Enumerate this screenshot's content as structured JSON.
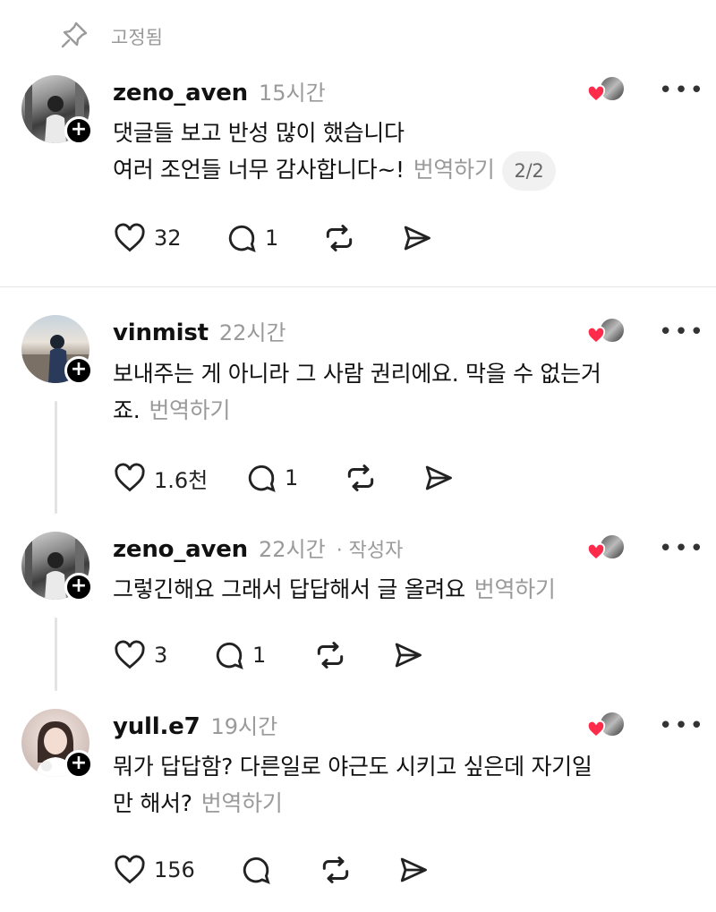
{
  "pinned": {
    "label": "고정됨"
  },
  "posts": [
    {
      "username": "zeno_aven",
      "time": "15시간",
      "lines": [
        "댓글들 보고 반성 많이 했습니다",
        "여러 조언들 너무 감사합니다~!"
      ],
      "translate": "번역하기",
      "pager": "2/2",
      "likes": "32",
      "replies": "1"
    },
    {
      "username": "vinmist",
      "time": "22시간",
      "lines": [
        "보내주는 게 아니라 그 사람 권리에요. 막을 수 없는거",
        "죠."
      ],
      "translate": "번역하기",
      "likes": "1.6천",
      "replies": "1"
    },
    {
      "username": "zeno_aven",
      "time": "22시간",
      "author_tag": "· 작성자",
      "lines": [
        "그렇긴해요 그래서 답답해서 글 올려요"
      ],
      "translate": "번역하기",
      "likes": "3",
      "replies": "1"
    },
    {
      "username": "yull.e7",
      "time": "19시간",
      "lines": [
        "뭐가 답답함? 다른일로 야근도 시키고 싶은데 자기일",
        "만 해서?"
      ],
      "translate": "번역하기",
      "likes": "156",
      "replies": ""
    }
  ],
  "colors": {
    "heart_red": "#ff2b4a",
    "muted": "#9a9a9a"
  },
  "icons": [
    "pin-icon",
    "heart-icon",
    "comment-icon",
    "repost-icon",
    "share-icon",
    "more-icon",
    "plus-icon"
  ]
}
